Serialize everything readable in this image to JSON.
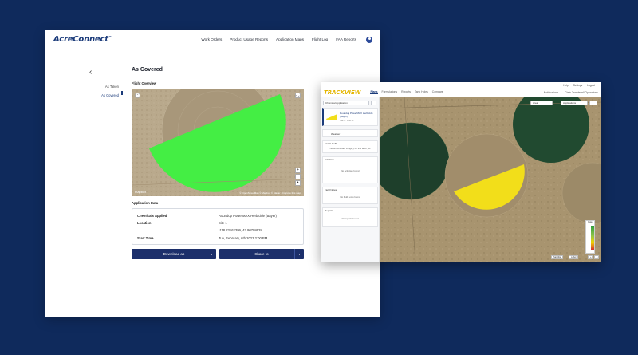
{
  "colors": {
    "background": "#0f2a5c",
    "brand": "#1b3b7a",
    "coverage_green": "#44ee44",
    "coverage_yellow": "#f2de1a",
    "button": "#1c2f6b"
  },
  "acreconnect": {
    "logo_part1": "Acre",
    "logo_part2": "Connect",
    "logo_tm": "™",
    "nav": [
      "Work Orders",
      "Product Usage Reports",
      "Application Maps",
      "Flight Log",
      "FAA Reports"
    ],
    "profile_icon": "user-circle-icon",
    "back_icon": "chevron-left-icon",
    "side_links": [
      "As Taken",
      "As Covered"
    ],
    "page_title": "As Covered",
    "flight_overview": "Flight Overview",
    "map_attribution": "© OpenStreetMap © Mapbox © Maxar · Improve this map",
    "map_logo": "mapbox",
    "application_data": "Application Data",
    "details": {
      "chem_label": "Chemicals Applied",
      "chem_value": "Roundup PowerMAX Herbicide (Bayer)",
      "location_label": "Location",
      "location_line1": "Site 1",
      "location_line2": "-118.23162399, 42.90798628",
      "start_label": "Start Time",
      "start_value": "Tue, February, 6th 2023 2:00 PM"
    },
    "download_label": "Download as",
    "share_label": "Share to"
  },
  "trackview": {
    "logo": "TRACKVIEW",
    "top_links": [
      "Help",
      "Settings",
      "Logout"
    ],
    "tabs": [
      "Plans",
      "Formulations",
      "Reports",
      "Tank Holes",
      "Compare"
    ],
    "right_links": [
      "Notifications",
      "Chris Trambwell Operations"
    ],
    "select_label": "Chemical Application",
    "product_name": "Roundup PowerMAX Herbicide (Bayer)",
    "product_sub": "Site 1 · 0.06 ac",
    "weather_label": "Weather",
    "field_health": "Field Health",
    "field_health_sub": "No orthomosaic imagery for this layer yet",
    "activities": "Activities",
    "activities_sub": "No activities found",
    "field_notes": "Field Notes",
    "field_notes_sub": "No field notes found",
    "reports": "Reports",
    "reports_sub": "No reports found",
    "map_dd1": "Area",
    "map_dd2": "Applications",
    "legend_title": "Rate",
    "mini_btns": [
      "Satellite",
      "Label"
    ]
  }
}
